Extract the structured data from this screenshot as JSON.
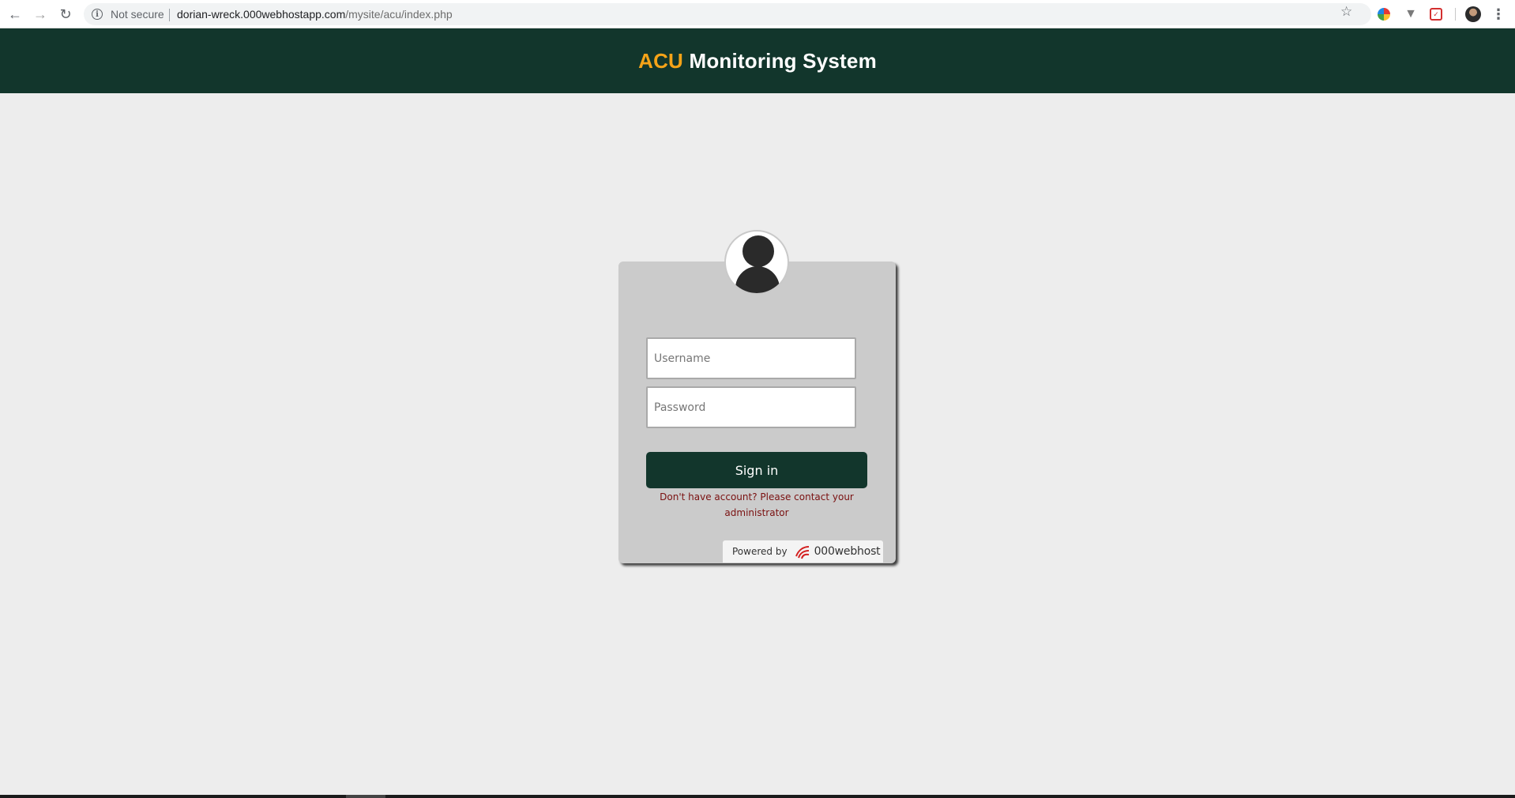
{
  "browser": {
    "security_label": "Not secure",
    "url_host": "dorian-wreck.000webhostapp.com",
    "url_path": "/mysite/acu/index.php",
    "back_icon": "←",
    "forward_icon": "→",
    "reload_icon": "↻",
    "star_icon": "☆",
    "menu_icon": "⋮"
  },
  "header": {
    "brand": "ACU",
    "title_rest": " Monitoring System",
    "brand_color": "#f5a318",
    "bg_color": "#12362c"
  },
  "login": {
    "username_placeholder": "Username",
    "password_placeholder": "Password",
    "signin_label": "Sign in",
    "note": "Don't have account? Please contact your administrator"
  },
  "footer_badge": {
    "powered_label": "Powered by",
    "host_name": "000webhost"
  }
}
